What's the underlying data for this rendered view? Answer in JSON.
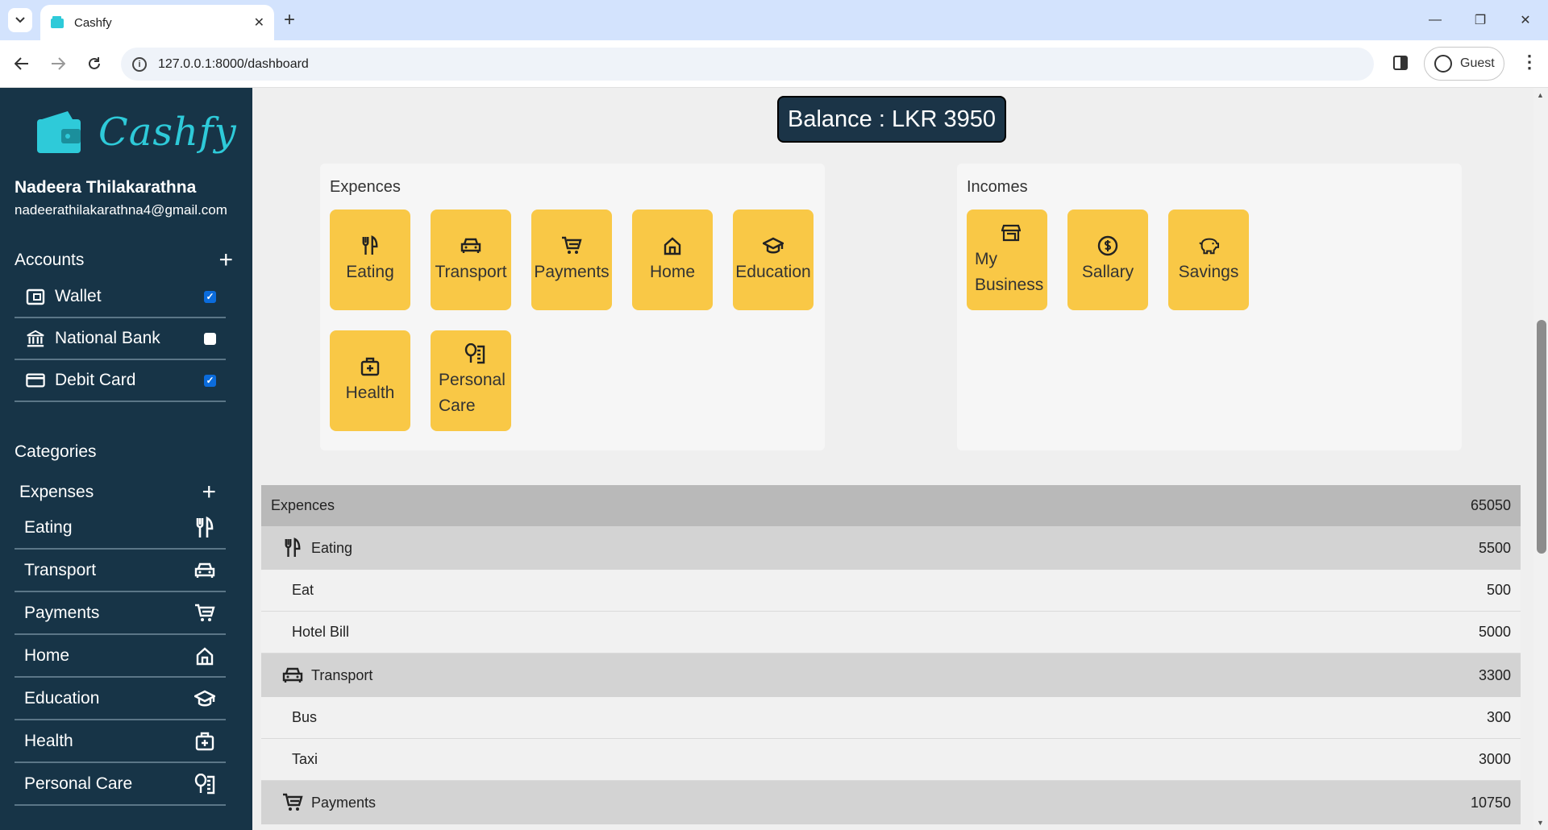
{
  "browser": {
    "tab_title": "Cashfy",
    "url": "127.0.0.1:8000/dashboard",
    "profile_label": "Guest"
  },
  "sidebar": {
    "logo_text": "Cashfy",
    "user_name": "Nadeera Thilakarathna",
    "user_email": "nadeerathilakarathna4@gmail.com",
    "accounts_heading": "Accounts",
    "accounts": [
      {
        "label": "Wallet",
        "checked": true,
        "icon": "wallet-icon"
      },
      {
        "label": "National Bank",
        "checked": false,
        "icon": "bank-icon"
      },
      {
        "label": "Debit Card",
        "checked": true,
        "icon": "card-icon"
      }
    ],
    "categories_heading": "Categories",
    "expenses_heading": "Expenses",
    "expense_categories": [
      {
        "label": "Eating",
        "icon": "utensils-icon"
      },
      {
        "label": "Transport",
        "icon": "car-icon"
      },
      {
        "label": "Payments",
        "icon": "cart-icon"
      },
      {
        "label": "Home",
        "icon": "home-icon"
      },
      {
        "label": "Education",
        "icon": "graduation-cap-icon"
      },
      {
        "label": "Health",
        "icon": "medical-kit-icon"
      },
      {
        "label": "Personal Care",
        "icon": "personal-care-icon"
      }
    ]
  },
  "main": {
    "balance": "Balance : LKR 3950",
    "expences_panel": {
      "title": "Expences",
      "tiles": [
        {
          "label": "Eating",
          "icon": "utensils-icon"
        },
        {
          "label": "Transport",
          "icon": "car-icon"
        },
        {
          "label": "Payments",
          "icon": "cart-icon"
        },
        {
          "label": "Home",
          "icon": "home-icon"
        },
        {
          "label": "Education",
          "icon": "graduation-cap-icon"
        },
        {
          "label": "Health",
          "icon": "medical-kit-icon"
        },
        {
          "label": "Personal Care",
          "icon": "personal-care-icon"
        }
      ]
    },
    "incomes_panel": {
      "title": "Incomes",
      "tiles": [
        {
          "label": "My Business",
          "icon": "store-icon"
        },
        {
          "label": "Sallary",
          "icon": "dollar-circle-icon"
        },
        {
          "label": "Savings",
          "icon": "piggy-bank-icon"
        }
      ]
    },
    "summary": {
      "total_label": "Expences",
      "total_value": "65050",
      "groups": [
        {
          "label": "Eating",
          "value": "5500",
          "icon": "utensils-icon",
          "items": [
            {
              "label": "Eat",
              "value": "500"
            },
            {
              "label": "Hotel Bill",
              "value": "5000"
            }
          ]
        },
        {
          "label": "Transport",
          "value": "3300",
          "icon": "car-icon",
          "items": [
            {
              "label": "Bus",
              "value": "300"
            },
            {
              "label": "Taxi",
              "value": "3000"
            }
          ]
        },
        {
          "label": "Payments",
          "value": "10750",
          "icon": "cart-icon",
          "items": []
        }
      ]
    }
  }
}
